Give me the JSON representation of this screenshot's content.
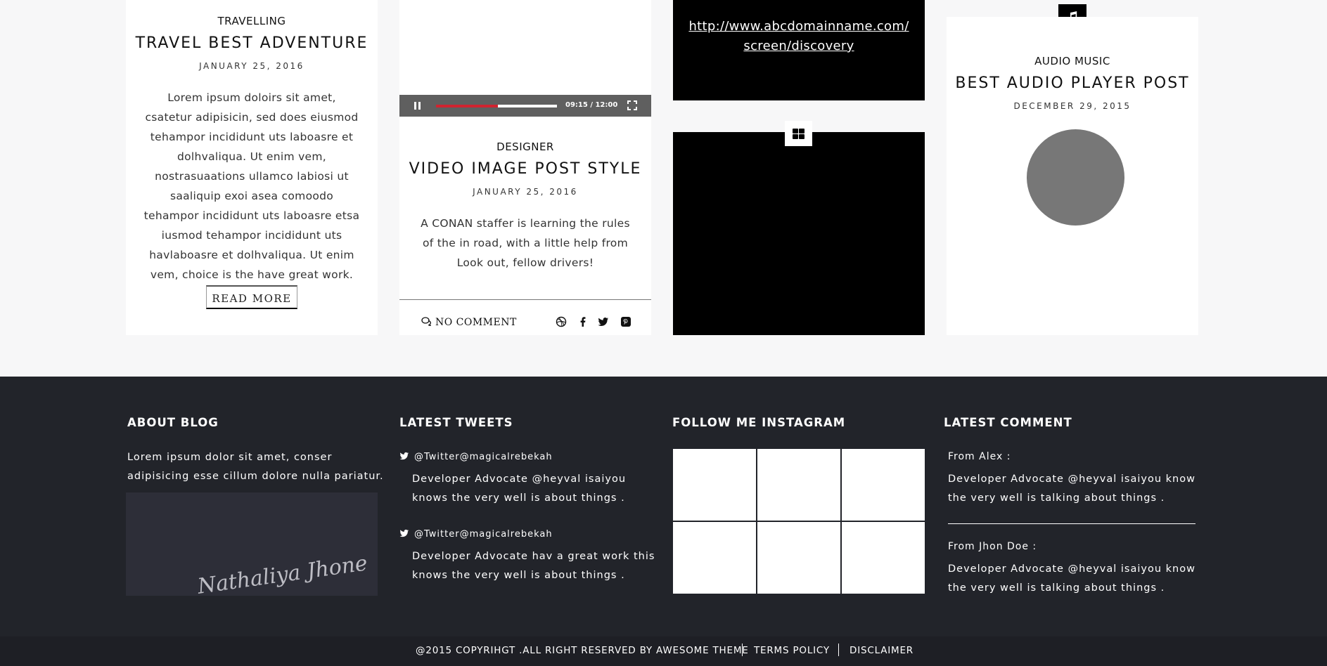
{
  "posts": [
    {
      "category": "TRAVELLING",
      "title": "TRAVEL BEST ADVENTURE",
      "date": "JANUARY 25, 2016",
      "body": "Lorem ipsum doloirs sit amet, csatetur adipisicin, sed does eiusmod tehampor incididunt uts laboasre et dolhvaliqua. Ut enim vem, nostrasuaations ullamco labiosi ut saaliquip exoi asea comoodo tehampor incididunt uts laboasre etsa iusmod tehampor incididunt uts havlaboasre et dolhvaliqua. Ut enim vem, choice is the have great work.",
      "read_more": "READ MORE"
    },
    {
      "category": "DESIGNER",
      "title": "VIDEO IMAGE POST STYLE",
      "date": "JANUARY 25, 2016",
      "body": "A CONAN staffer is learning the rules of the in road, with a little help from Look out, fellow drivers!",
      "video": {
        "time": "09:15 / 12:00",
        "progress_fraction": 0.51,
        "progress_color": "#d0232f"
      },
      "comment_link": "NO COMMENT",
      "share_icons": [
        "dribbble-icon",
        "facebook-icon",
        "twitter-icon",
        "pinterest-icon"
      ]
    },
    {
      "link": "http://www.abcdomainname.com/ screen/discovery"
    },
    {
      "format_icon": "gallery-grid-icon"
    },
    {
      "format_icon": "music-note-icon",
      "category": "AUDIO MUSIC",
      "title": "BEST AUDIO PLAYER POST",
      "date": "DECEMBER 29, 2015"
    }
  ],
  "footer": {
    "about": {
      "heading": "ABOUT BLOG",
      "text": "Lorem ipsum dolor sit amet, conser adipisicing esse cillum dolore nulla pariatur.",
      "signature": "Nathaliya Jhone"
    },
    "tweets": {
      "heading": "LATEST TWEETS",
      "items": [
        {
          "handle": "@Twitter@magicalrebekah",
          "text": "Developer Advocate @heyval isaiyou knows the very well is about things ."
        },
        {
          "handle": "@Twitter@magicalrebekah",
          "text": "Developer Advocate hav a great work this knows the very well is about things ."
        }
      ]
    },
    "instagram": {
      "heading": "FOLLOW ME INSTAGRAM",
      "tile_count": 6
    },
    "comments": {
      "heading": "LATEST COMMENT",
      "items": [
        {
          "from": "From Alex :",
          "text": "Developer Advocate @heyval isaiyou know the very well is talking about things ."
        },
        {
          "from": "From Jhon Doe :",
          "text": "Developer Advocate @heyval isaiyou know the very well is talking about things ."
        }
      ]
    },
    "copyright": "@2015 COPYRIHGT .ALL RIGHT RESERVED BY AWESOME THEME",
    "links": [
      "TERMS POLICY",
      "DISCLAIMER"
    ]
  },
  "colors": {
    "footer_bg": "#22242a",
    "copybar_bg": "#1e1f25",
    "page_bg": "#f7f7f8",
    "video_bar": "#5f5f5f"
  }
}
